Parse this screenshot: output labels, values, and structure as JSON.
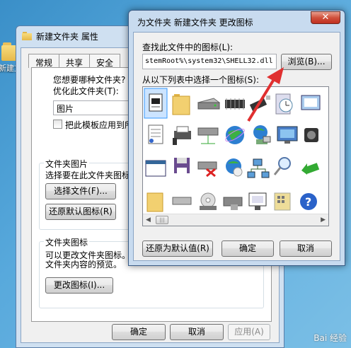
{
  "desktop": {
    "icon_label": "新建文"
  },
  "properties": {
    "title": "新建文件夹 属性",
    "tabs": [
      "常规",
      "共享",
      "安全"
    ],
    "question": "您想要哪种文件夹?",
    "optimize_label": "优化此文件夹(T):",
    "optimize_value": "图片",
    "template_checkbox": "把此模板应用到所",
    "folder_pictures_title": "文件夹图片",
    "folder_pictures_desc": "选择要在此文件夹图标",
    "choose_file_btn": "选择文件(F)...",
    "restore_default_btn": "还原默认图标(R)",
    "folder_icon_title": "文件夹图标",
    "folder_icon_desc1": "可以更改文件夹图标。",
    "folder_icon_desc2": "文件夹内容的预览。",
    "change_icon_btn": "更改图标(I)...",
    "ok": "确定",
    "cancel": "取消",
    "apply": "应用(A)"
  },
  "change_icon_dialog": {
    "title": "为文件夹 新建文件夹 更改图标",
    "find_label": "查找此文件中的图标(L):",
    "path_value": "stemRoot%\\system32\\SHELL32.dll",
    "browse_btn": "浏览(B)...",
    "list_label": "从以下列表中选择一个图标(S):",
    "icons": [
      "document-icon",
      "folder-icon",
      "drive-icon",
      "chip-icon",
      "cable-icon",
      "clock-icon",
      "window-icon",
      "extra-icon",
      "text-document-icon",
      "printer-icon",
      "network-drive-icon",
      "globe-icon",
      "network-globe-icon",
      "desktop-icon",
      "speaker-icon",
      "shortcut-icon",
      "window-app-icon",
      "floppy-icon",
      "disconnected-drive-icon",
      "globe-cd-icon",
      "network-icon",
      "search-icon",
      "back-arrow-icon",
      "extra-icon2",
      "folder-open-icon",
      "drive2-icon",
      "cd-drive-icon",
      "drive-lock-icon",
      "monitor-icon",
      "grid-icon",
      "help-icon",
      "shutdown-icon"
    ],
    "restore_default_btn": "还原为默认值(R)",
    "ok": "确定",
    "cancel": "取消"
  },
  "watermark": "Bai 经验",
  "colors": {
    "accent_arrow": "#e03030",
    "selection": "#3399ff"
  }
}
